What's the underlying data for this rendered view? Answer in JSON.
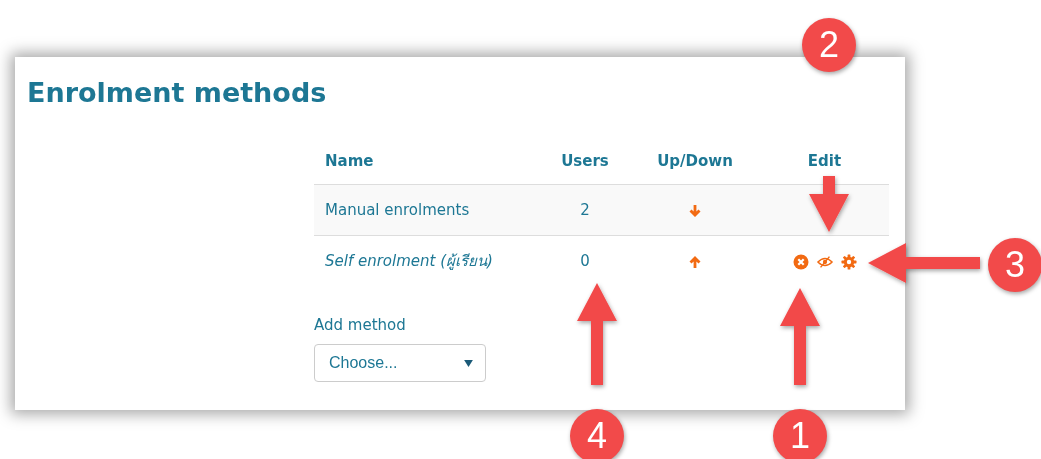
{
  "heading": "Enrolment methods",
  "table": {
    "columns": [
      "Name",
      "Users",
      "Up/Down",
      "Edit"
    ],
    "rows": [
      {
        "name": "Manual enrolments",
        "enabled": true,
        "users": "2",
        "can_move_up": false,
        "can_move_down": true,
        "actions": []
      },
      {
        "name": "Self enrolment (ผู้เรียน)",
        "enabled": false,
        "users": "0",
        "can_move_up": true,
        "can_move_down": false,
        "actions": [
          {
            "kind": "delete"
          },
          {
            "kind": "show"
          },
          {
            "kind": "settings"
          }
        ]
      }
    ]
  },
  "add_method": {
    "label": "Add method",
    "value": "Choose..."
  },
  "callouts": [
    {
      "number": "2",
      "kind": "down"
    },
    {
      "number": "3",
      "kind": "left"
    },
    {
      "number": "4",
      "kind": "up"
    },
    {
      "number": "1",
      "kind": "up"
    }
  ]
}
